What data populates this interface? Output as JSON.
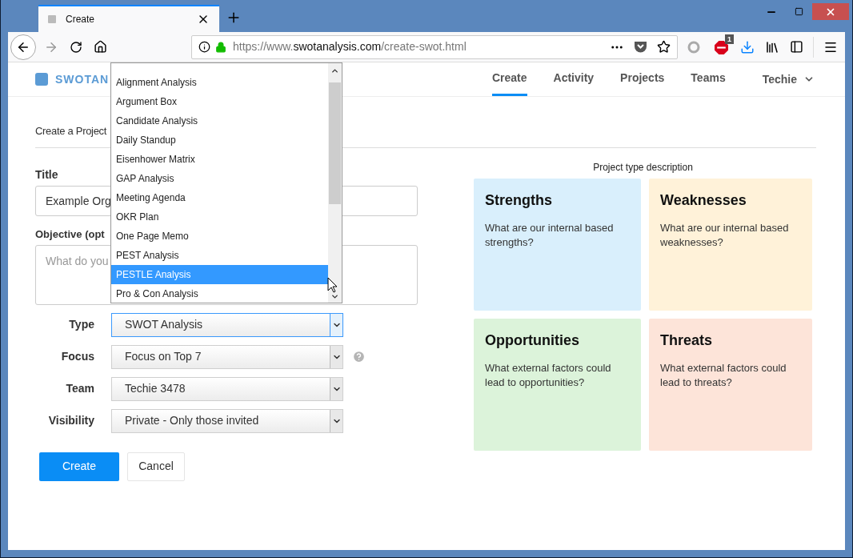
{
  "browser": {
    "tab_title": "Create",
    "url_host": "https://www.",
    "url_domain": "swotanalysis.com",
    "url_path": "/create-swot.html",
    "extension_badge": "1"
  },
  "site": {
    "logo_text": "SWOTAN",
    "nav": [
      {
        "label": "Create",
        "selected": true
      },
      {
        "label": "Activity",
        "selected": false
      },
      {
        "label": "Projects",
        "selected": false
      },
      {
        "label": "Teams",
        "selected": false
      }
    ],
    "user": "Techie"
  },
  "form": {
    "heading": "Create a Project",
    "title_label": "Title",
    "title_value": "Example Org",
    "objective_label": "Objective (opt",
    "objective_placeholder": "What do you",
    "selects": [
      {
        "label": "Type",
        "value": "SWOT Analysis",
        "focused": true,
        "help": false
      },
      {
        "label": "Focus",
        "value": "Focus on Top 7",
        "focused": false,
        "help": true
      },
      {
        "label": "Team",
        "value": "Techie 3478",
        "focused": false,
        "help": false
      },
      {
        "label": "Visibility",
        "value": "Private - Only those invited",
        "focused": false,
        "help": false
      }
    ],
    "buttons": [
      {
        "label": "Create",
        "kind": "primary"
      },
      {
        "label": "Cancel",
        "kind": "secondary"
      }
    ]
  },
  "dropdown": {
    "items": [
      {
        "label": "Alignment Analysis",
        "selected": false
      },
      {
        "label": "Argument Box",
        "selected": false
      },
      {
        "label": "Candidate Analysis",
        "selected": false
      },
      {
        "label": "Daily Standup",
        "selected": false
      },
      {
        "label": "Eisenhower Matrix",
        "selected": false
      },
      {
        "label": "GAP Analysis",
        "selected": false
      },
      {
        "label": "Meeting Agenda",
        "selected": false
      },
      {
        "label": "OKR Plan",
        "selected": false
      },
      {
        "label": "One Page Memo",
        "selected": false
      },
      {
        "label": "PEST Analysis",
        "selected": false
      },
      {
        "label": "PESTLE Analysis",
        "selected": true
      },
      {
        "label": "Pro & Con Analysis",
        "selected": false
      }
    ]
  },
  "description": {
    "title": "Project type description",
    "cards": [
      {
        "title": "Strengths",
        "text": "What are our internal based strengths?",
        "color": "#d9effc"
      },
      {
        "title": "Weaknesses",
        "text": "What are our internal based weaknesses?",
        "color": "#fff2d9"
      },
      {
        "title": "Opportunities",
        "text": "What external factors could lead to opportunities?",
        "color": "#dcf3da"
      },
      {
        "title": "Threats",
        "text": "What external factors could lead to threats?",
        "color": "#fde4d9"
      }
    ]
  }
}
